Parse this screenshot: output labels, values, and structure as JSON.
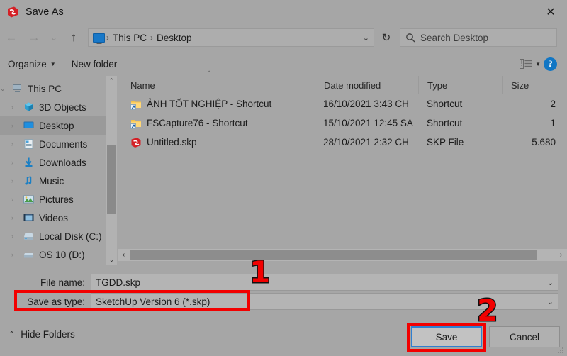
{
  "window": {
    "title": "Save As",
    "icon": "sketchup-icon",
    "close_label": "✕"
  },
  "nav": {
    "back_icon": "arrow-left-icon",
    "forward_icon": "arrow-right-icon",
    "recent_icon": "chevron-down-icon",
    "up_icon": "arrow-up-icon",
    "address": {
      "icon": "this-pc-icon",
      "crumbs": [
        "This PC",
        "Desktop"
      ],
      "separator": "›",
      "caret": "⌄"
    },
    "refresh_icon": "refresh-icon",
    "search": {
      "placeholder": "Search Desktop",
      "icon": "search-icon"
    }
  },
  "command_bar": {
    "organize_label": "Organize",
    "organize_caret": "▼",
    "new_folder_label": "New folder",
    "view_icon": "view-layout-icon",
    "view_caret": "▼",
    "help_icon": "help-icon",
    "help_label": "?"
  },
  "tree": {
    "items": [
      {
        "label": "This PC",
        "icon": "this-pc-icon",
        "indent": 0,
        "expanded": true,
        "selected": false
      },
      {
        "label": "3D Objects",
        "icon": "3d-objects-icon",
        "indent": 1,
        "expanded": false,
        "selected": false
      },
      {
        "label": "Desktop",
        "icon": "desktop-icon",
        "indent": 1,
        "expanded": false,
        "selected": true
      },
      {
        "label": "Documents",
        "icon": "documents-icon",
        "indent": 1,
        "expanded": false,
        "selected": false
      },
      {
        "label": "Downloads",
        "icon": "downloads-icon",
        "indent": 1,
        "expanded": false,
        "selected": false
      },
      {
        "label": "Music",
        "icon": "music-icon",
        "indent": 1,
        "expanded": false,
        "selected": false
      },
      {
        "label": "Pictures",
        "icon": "pictures-icon",
        "indent": 1,
        "expanded": false,
        "selected": false
      },
      {
        "label": "Videos",
        "icon": "videos-icon",
        "indent": 1,
        "expanded": false,
        "selected": false
      },
      {
        "label": "Local Disk (C:)",
        "icon": "disk-icon",
        "indent": 1,
        "expanded": false,
        "selected": false
      },
      {
        "label": "OS 10 (D:)",
        "icon": "disk-icon",
        "indent": 1,
        "expanded": false,
        "selected": false
      }
    ],
    "scroll_up": "⌃",
    "scroll_down": "⌄"
  },
  "file_list": {
    "columns": [
      "Name",
      "Date modified",
      "Type",
      "Size"
    ],
    "sort_caret": "⌃",
    "rows": [
      {
        "name": "ẢNH TỐT NGHIỆP - Shortcut",
        "date": "16/10/2021 3:43 CH",
        "type": "Shortcut",
        "size": "2",
        "icon": "shortcut-icon"
      },
      {
        "name": "FSCapture76 - Shortcut",
        "date": "15/10/2021 12:45 SA",
        "type": "Shortcut",
        "size": "1",
        "icon": "shortcut-icon"
      },
      {
        "name": "Untitled.skp",
        "date": "28/10/2021 2:32 CH",
        "type": "SKP File",
        "size": "5.680",
        "icon": "sketchup-file-icon"
      }
    ],
    "hscroll_left": "‹",
    "hscroll_right": "›"
  },
  "form": {
    "file_name_label": "File name:",
    "file_name_value": "TGDD.skp",
    "save_as_type_label": "Save as type:",
    "save_as_type_value": "SketchUp Version 6 (*.skp)",
    "dropdown_caret": "⌄",
    "hide_folders_label": "Hide Folders",
    "hide_folders_chevron": "⌃",
    "save_button": "Save",
    "cancel_button": "Cancel"
  },
  "annotations": {
    "step_one": "1",
    "step_two": "2",
    "highlight_color": "#f20000"
  }
}
